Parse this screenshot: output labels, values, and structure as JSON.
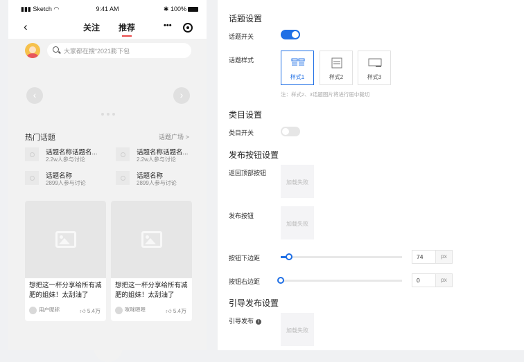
{
  "phone": {
    "status": {
      "carrier": "Sketch",
      "time": "9:41 AM",
      "battery": "100%"
    },
    "nav": {
      "back": "‹",
      "tab_follow": "关注",
      "tab_recommend": "推荐",
      "capsule_dots": "•••"
    },
    "search_placeholder": "大家都在搜“2021膨下包",
    "banner": {
      "prev": "‹",
      "next": "›"
    },
    "hot": {
      "title": "热门话题",
      "more": "话题广场 >",
      "topics": [
        {
          "name": "话题名称话题名...",
          "count": "2.2w人参与讨论"
        },
        {
          "name": "话题名称话题名...",
          "count": "2.2w人参与讨论"
        },
        {
          "name": "话题名称",
          "count": "2899人参与讨论"
        },
        {
          "name": "话题名称",
          "count": "2899人参与讨论"
        }
      ]
    },
    "cards": [
      {
        "title": "想把这一杯分享给所有减肥的姐妹！太刮油了",
        "author": "用户昵称",
        "likes": "5.4万"
      },
      {
        "title": "想把这一杯分享给所有减肥的姐妹！太刮油了",
        "author": "咪咪嗯嗯",
        "likes": "5.4万"
      }
    ]
  },
  "settings": {
    "topic": {
      "heading": "话题设置",
      "switch_label": "话题开关",
      "switch_on": true,
      "style_label": "话题样式",
      "styles": [
        "样式1",
        "样式2",
        "样式3"
      ],
      "selected_style": 0,
      "note": "注：样式2、3话题图片将进行居中裁切"
    },
    "category": {
      "heading": "类目设置",
      "switch_label": "类目开关",
      "switch_on": false
    },
    "publish": {
      "heading": "发布按钮设置",
      "back_top_label": "返回顶部按钮",
      "publish_label": "发布按钮",
      "load_failed": "加载失败",
      "bottom_margin_label": "按钮下边距",
      "bottom_margin_value": "74",
      "right_margin_label": "按钮右边距",
      "right_margin_value": "0",
      "unit": "px"
    },
    "guide": {
      "heading": "引导发布设置",
      "label": "引导发布",
      "load_failed": "加载失败"
    }
  },
  "colors": {
    "accent": "#1f6fe5",
    "tab_underline": "#e84b4b",
    "toggle_off": "#e6e6e6"
  },
  "slider_levels": {
    "bottom_margin_fraction": 0.07,
    "right_margin_fraction": 0.0
  }
}
